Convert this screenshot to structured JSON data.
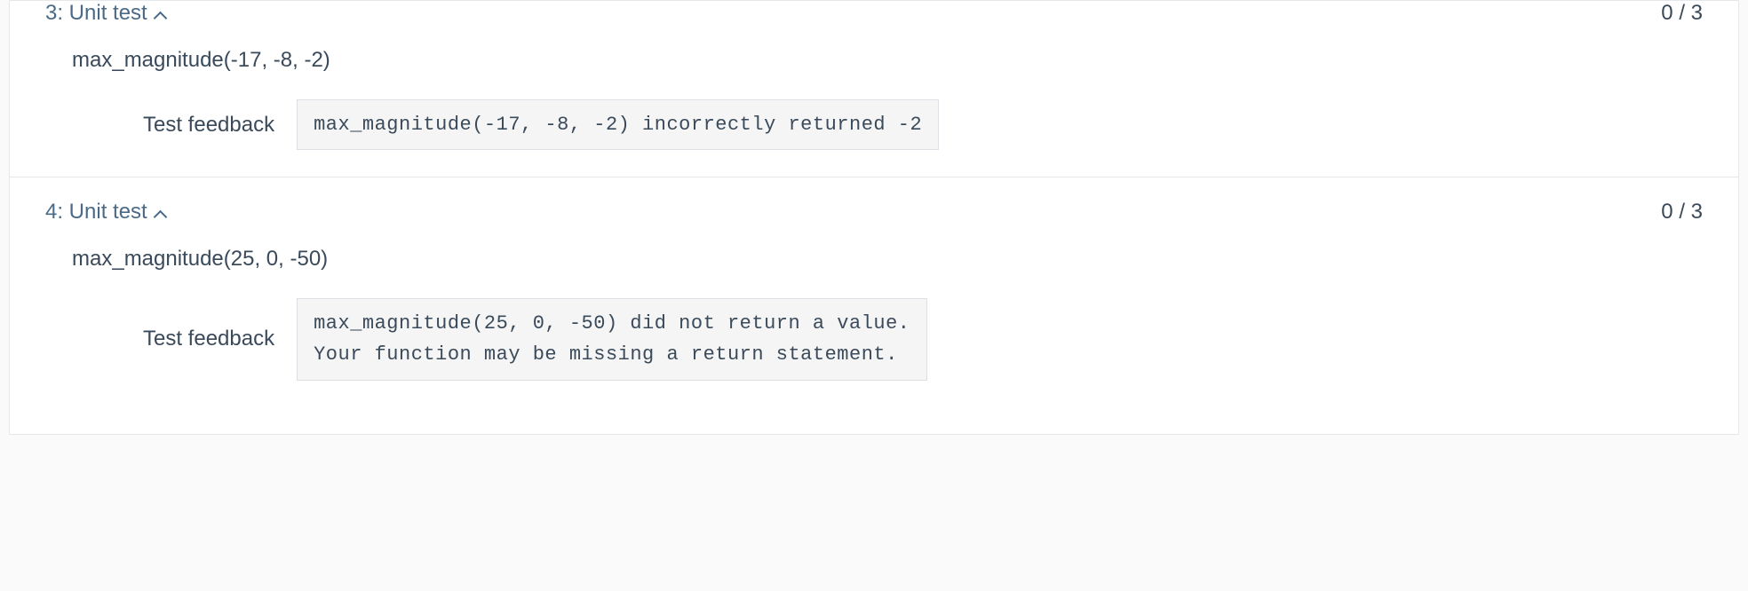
{
  "tests": [
    {
      "header": "3: Unit test",
      "score": "0 / 3",
      "call": "max_magnitude(-17, -8, -2)",
      "feedback_label": "Test feedback",
      "feedback_text": "max_magnitude(-17, -8, -2) incorrectly returned -2"
    },
    {
      "header": "4: Unit test",
      "score": "0 / 3",
      "call": "max_magnitude(25, 0, -50)",
      "feedback_label": "Test feedback",
      "feedback_text": "max_magnitude(25, 0, -50) did not return a value.\nYour function may be missing a return statement."
    }
  ]
}
